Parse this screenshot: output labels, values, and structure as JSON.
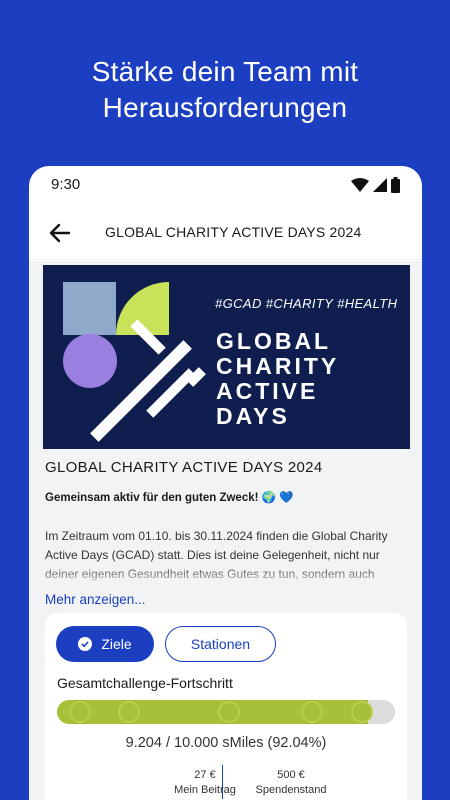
{
  "promo": {
    "line1": "Stärke dein Team mit",
    "line2": "Herausforderungen"
  },
  "status_bar": {
    "time": "9:30",
    "icons": [
      "wifi-icon",
      "signal-icon",
      "battery-icon"
    ]
  },
  "app_bar": {
    "back_icon": "arrow-left-icon",
    "title": "GLOBAL CHARITY ACTIVE DAYS 2024"
  },
  "banner": {
    "tags": "#GCAD #CHARITY #HEALTH",
    "title_lines": [
      "GLOBAL",
      "CHARITY",
      "ACTIVE",
      "DAYS"
    ],
    "colors": {
      "background": "#0f1d4f",
      "square": "#8ea9c9",
      "quarter": "#c8e25a",
      "circle": "#9b7fe0"
    }
  },
  "event": {
    "title": "GLOBAL CHARITY ACTIVE DAYS 2024",
    "subtitle": "Gemeinsam aktiv für den guten Zweck! 🌍 💙",
    "description": "Im Zeitraum vom 01.10. bis 30.11.2024 finden die Global Charity Active Days (GCAD) statt. Dies ist deine Gelegenheit, nicht nur deiner eigenen Gesundheit etwas Gutes zu tun, sondern auch",
    "more_link": "Mehr anzeigen..."
  },
  "challenge": {
    "tabs": [
      {
        "label": "Ziele",
        "active": true,
        "icon": "check-icon"
      },
      {
        "label": "Stationen",
        "active": false
      }
    ],
    "progress_label": "Gesamtchallenge-Fortschritt",
    "progress_fraction": 0.9204,
    "progress_text": "9.204 / 10.000 sMiles (92.04%)",
    "stats": [
      {
        "value": "27 €",
        "label": "Mein Beitrag"
      },
      {
        "value": "500 €",
        "label": "Spendenstand"
      }
    ]
  },
  "colors": {
    "brand_blue": "#1b3fc0",
    "progress_green": "#a7c03a",
    "track_grey": "#dcdcdc"
  }
}
